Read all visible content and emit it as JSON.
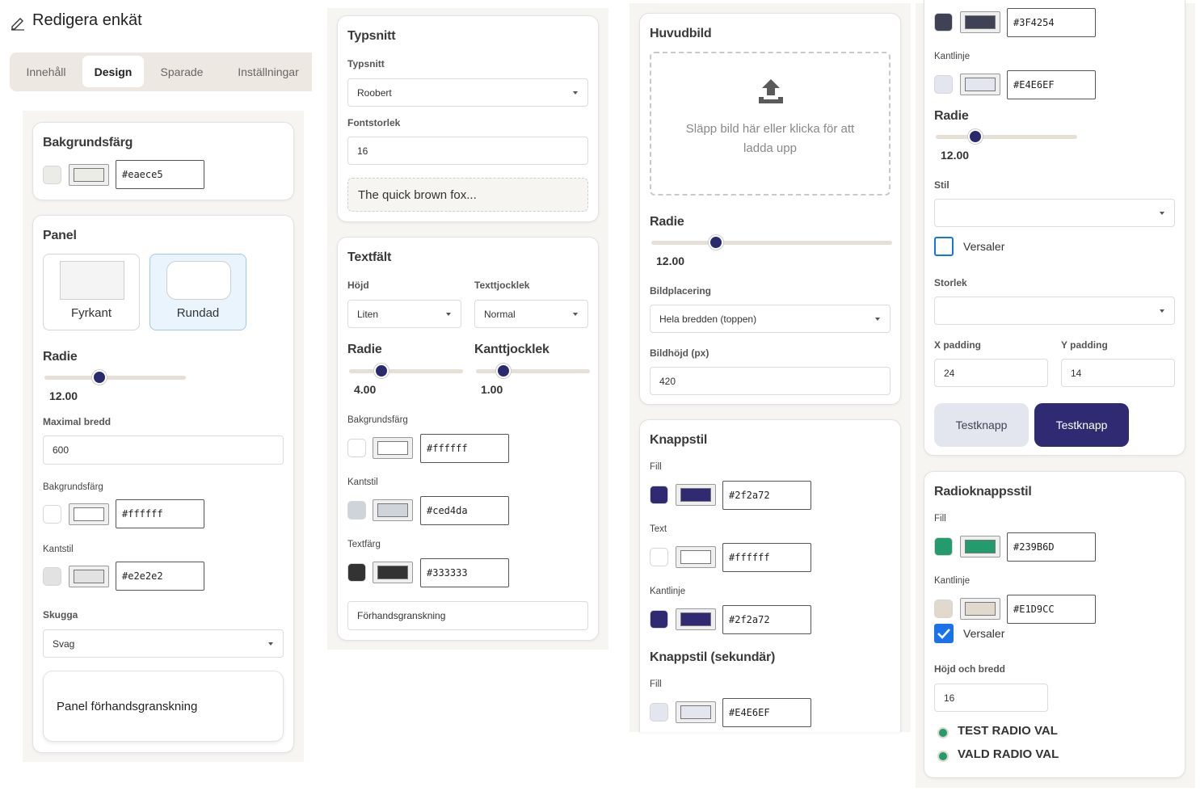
{
  "header": {
    "title": "Redigera enkät"
  },
  "tabs": [
    {
      "label": "Innehåll"
    },
    {
      "label": "Design"
    },
    {
      "label": "Sparade"
    },
    {
      "label": "Inställningar"
    }
  ],
  "col1": {
    "bg_card": {
      "title": "Bakgrundsfärg",
      "color": "#eaece5",
      "hex": "#eaece5"
    },
    "panel_card": {
      "title": "Panel",
      "shape_options": [
        {
          "label": "Fyrkant"
        },
        {
          "label": "Rundad"
        }
      ],
      "radius_label": "Radie",
      "radius_value": "12.00",
      "radius_fraction": 0.39,
      "max_width_label": "Maximal bredd",
      "max_width_value": "600",
      "bg_label": "Bakgrundsfärg",
      "bg_hex": "#ffffff",
      "border_label": "Kantstil",
      "border_hex": "#e2e2e2",
      "shadow_label": "Skugga",
      "shadow_value": "Svag",
      "preview_text": "Panel förhandsgranskning"
    }
  },
  "col2": {
    "font_card": {
      "title": "Typsnitt",
      "font_label": "Typsnitt",
      "font_value": "Roobert",
      "size_label": "Fontstorlek",
      "size_value": "16",
      "preview": "The quick brown fox..."
    },
    "textfield_card": {
      "title": "Textfält",
      "height_label": "Höjd",
      "height_value": "Liten",
      "weight_label": "Texttjocklek",
      "weight_value": "Normal",
      "radius_label": "Radie",
      "radius_value": "4.00",
      "radius_fraction": 0.28,
      "border_width_label": "Kanttjocklek",
      "border_width_value": "1.00",
      "border_width_fraction": 0.24,
      "bg_label": "Bakgrundsfärg",
      "bg_hex": "#ffffff",
      "border_label": "Kantstil",
      "border_hex": "#ced4da",
      "text_color_label": "Textfärg",
      "text_hex": "#333333",
      "preview_text": "Förhandsgranskning"
    }
  },
  "col3": {
    "hero_card": {
      "title": "Huvudbild",
      "drop_text": "Släpp bild här eller klicka för att ladda upp",
      "radius_label": "Radie",
      "radius_value": "12.00",
      "radius_fraction": 0.27,
      "placement_label": "Bildplacering",
      "placement_value": "Hela bredden (toppen)",
      "height_label": "Bildhöjd (px)",
      "height_value": "420"
    },
    "button_card": {
      "title": "Knappstil",
      "fill_label": "Fill",
      "fill_hex": "#2f2a72",
      "text_label": "Text",
      "text_hex": "#ffffff",
      "border_label": "Kantlinje",
      "border_hex": "#2f2a72",
      "secondary_title": "Knappstil (sekundär)",
      "secondary_fill_label": "Fill",
      "secondary_fill_hex": "#E4E6EF"
    }
  },
  "col4": {
    "secondary_cont": {
      "text_hex": "#3F4254",
      "border_label": "Kantlinje",
      "border_hex": "#E4E6EF",
      "radius_label": "Radie",
      "radius_value": "12.00",
      "radius_fraction": 0.28,
      "style_label": "Stil",
      "style_value": "",
      "uppercase_label": "Versaler",
      "uppercase_checked": false,
      "size_label": "Storlek",
      "size_value": "",
      "xpad_label": "X padding",
      "xpad_value": "24",
      "ypad_label": "Y padding",
      "ypad_value": "14",
      "test_secondary": "Testknapp",
      "test_primary": "Testknapp"
    },
    "radio_card": {
      "title": "Radioknappsstil",
      "fill_label": "Fill",
      "fill_hex": "#239B6D",
      "border_label": "Kantlinje",
      "border_hex": "#E1D9CC",
      "uppercase_label": "Versaler",
      "uppercase_checked": true,
      "size_label": "Höjd och bredd",
      "size_value": "16",
      "options": [
        {
          "label": "TEST RADIO VAL"
        },
        {
          "label": "VALD RADIO VAL"
        }
      ]
    }
  },
  "colors": {
    "accent_navy": "#2f2a72",
    "tab_bar_bg": "#ede9e2",
    "section_bg": "#f6f5f2",
    "radio_green": "#239B6D",
    "checkbox_blue": "#1a73e8"
  }
}
